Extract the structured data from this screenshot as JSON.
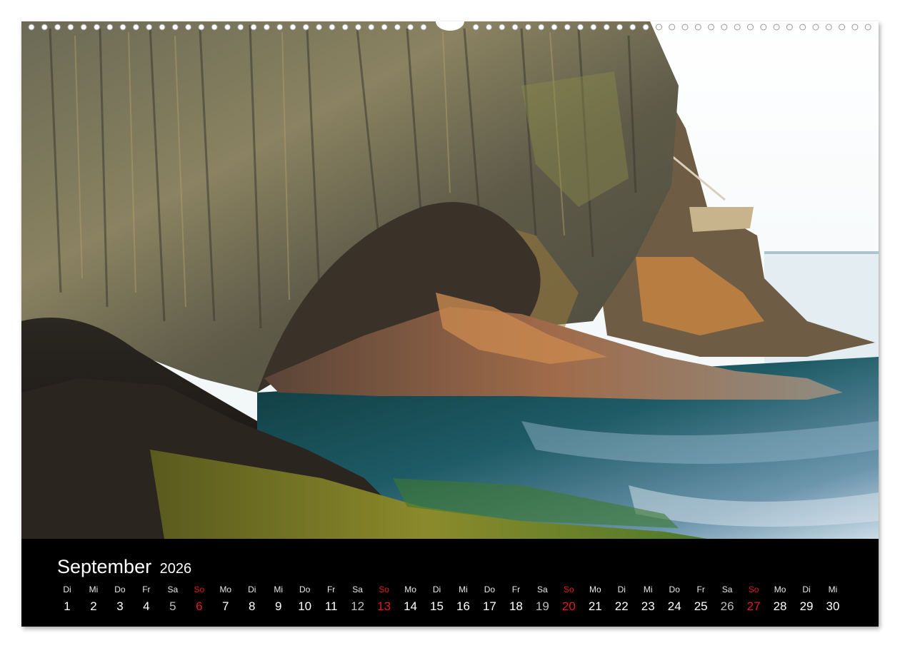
{
  "calendar": {
    "month": "September",
    "year": "2026",
    "days": [
      {
        "wd": "Di",
        "d": "1",
        "kind": "weekday"
      },
      {
        "wd": "Mi",
        "d": "2",
        "kind": "weekday"
      },
      {
        "wd": "Do",
        "d": "3",
        "kind": "weekday"
      },
      {
        "wd": "Fr",
        "d": "4",
        "kind": "weekday"
      },
      {
        "wd": "Sa",
        "d": "5",
        "kind": "saturday"
      },
      {
        "wd": "So",
        "d": "6",
        "kind": "sunday"
      },
      {
        "wd": "Mo",
        "d": "7",
        "kind": "weekday"
      },
      {
        "wd": "Di",
        "d": "8",
        "kind": "weekday"
      },
      {
        "wd": "Mi",
        "d": "9",
        "kind": "weekday"
      },
      {
        "wd": "Do",
        "d": "10",
        "kind": "weekday"
      },
      {
        "wd": "Fr",
        "d": "11",
        "kind": "weekday"
      },
      {
        "wd": "Sa",
        "d": "12",
        "kind": "saturday"
      },
      {
        "wd": "So",
        "d": "13",
        "kind": "sunday"
      },
      {
        "wd": "Mo",
        "d": "14",
        "kind": "weekday"
      },
      {
        "wd": "Di",
        "d": "15",
        "kind": "weekday"
      },
      {
        "wd": "Mi",
        "d": "16",
        "kind": "weekday"
      },
      {
        "wd": "Do",
        "d": "17",
        "kind": "weekday"
      },
      {
        "wd": "Fr",
        "d": "18",
        "kind": "weekday"
      },
      {
        "wd": "Sa",
        "d": "19",
        "kind": "saturday"
      },
      {
        "wd": "So",
        "d": "20",
        "kind": "sunday"
      },
      {
        "wd": "Mo",
        "d": "21",
        "kind": "weekday"
      },
      {
        "wd": "Di",
        "d": "22",
        "kind": "weekday"
      },
      {
        "wd": "Mi",
        "d": "23",
        "kind": "weekday"
      },
      {
        "wd": "Do",
        "d": "24",
        "kind": "weekday"
      },
      {
        "wd": "Fr",
        "d": "25",
        "kind": "weekday"
      },
      {
        "wd": "Sa",
        "d": "26",
        "kind": "saturday"
      },
      {
        "wd": "So",
        "d": "27",
        "kind": "sunday"
      },
      {
        "wd": "Mo",
        "d": "28",
        "kind": "weekday"
      },
      {
        "wd": "Di",
        "d": "29",
        "kind": "weekday"
      },
      {
        "wd": "Mi",
        "d": "30",
        "kind": "weekday"
      }
    ]
  },
  "colors": {
    "sunday": "#e3191f",
    "saturday": "#bdbdbd",
    "background": "#000000"
  },
  "photo": {
    "icon": "sea-cliff-photo"
  }
}
